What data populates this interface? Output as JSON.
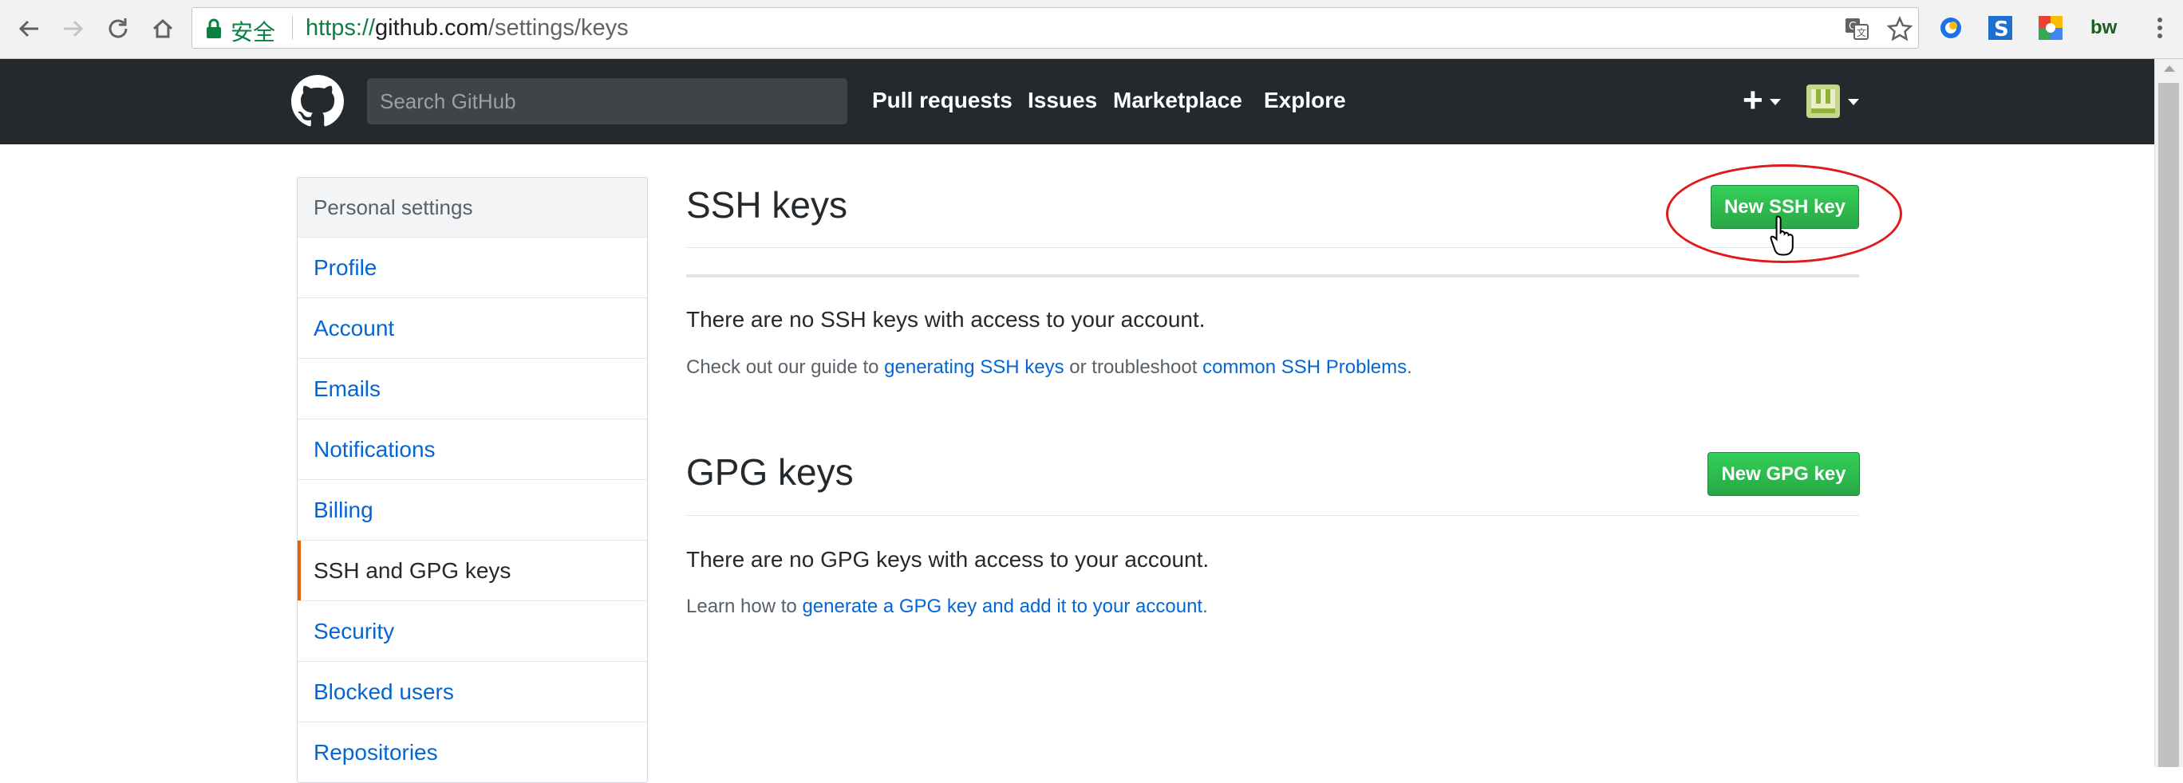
{
  "browser": {
    "secure_label": "安全",
    "url_scheme": "https://",
    "url_host": "github.com",
    "url_path": "/settings/keys",
    "nav_icons": [
      "back-icon",
      "forward-icon",
      "reload-icon",
      "home-icon"
    ],
    "omnibox_icons": [
      "translate-icon",
      "bookmark-star-icon"
    ],
    "extension_icons": [
      "extension-1-icon",
      "extension-s-icon",
      "extension-colorful-icon",
      "extension-bw-icon",
      "menu-kebab-icon"
    ],
    "extension_bw_label": "bw"
  },
  "header": {
    "search_placeholder": "Search GitHub",
    "nav": [
      "Pull requests",
      "Issues",
      "Marketplace",
      "Explore"
    ],
    "plus_label": "+"
  },
  "sidebar": {
    "heading": "Personal settings",
    "items": [
      {
        "label": "Profile"
      },
      {
        "label": "Account"
      },
      {
        "label": "Emails"
      },
      {
        "label": "Notifications"
      },
      {
        "label": "Billing"
      },
      {
        "label": "SSH and GPG keys",
        "selected": true
      },
      {
        "label": "Security"
      },
      {
        "label": "Blocked users"
      },
      {
        "label": "Repositories"
      }
    ]
  },
  "ssh": {
    "title": "SSH keys",
    "button": "New SSH key",
    "blank": "There are no SSH keys with access to your account.",
    "help_prefix": "Check out our guide to ",
    "help_link1": "generating SSH keys",
    "help_middle": " or troubleshoot ",
    "help_link2": "common SSH Problems",
    "help_suffix": "."
  },
  "gpg": {
    "title": "GPG keys",
    "button": "New GPG key",
    "blank": "There are no GPG keys with access to your account.",
    "help_prefix": "Learn how to ",
    "help_link": "generate a GPG key and add it to your account",
    "help_suffix": "."
  },
  "colors": {
    "header_bg": "#24292e",
    "link": "#0366d6",
    "button_green": "#28a745",
    "selected_accent": "#e36209",
    "annotation_red": "#e0191a"
  }
}
